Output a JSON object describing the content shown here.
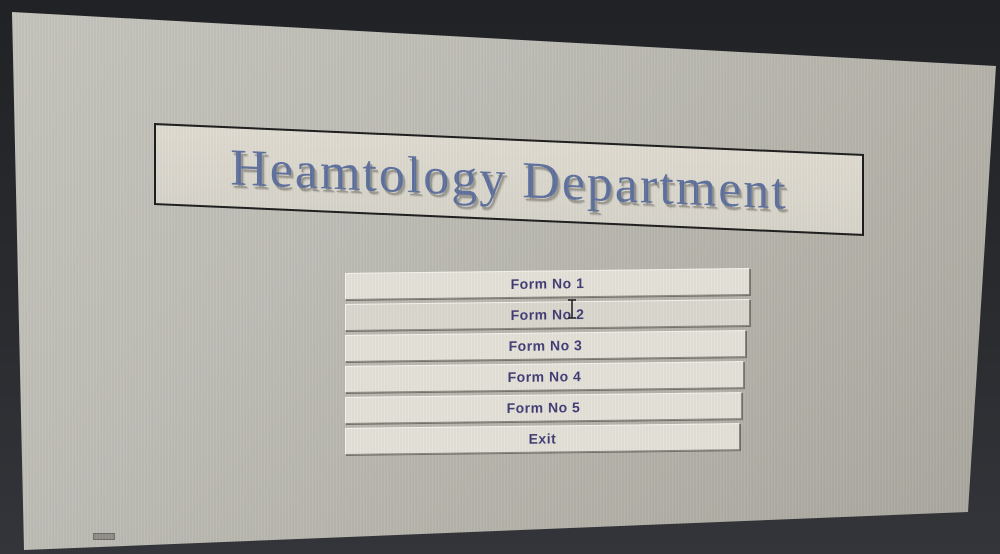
{
  "window": {
    "title": "Heamtology Department"
  },
  "menu": {
    "buttons": [
      {
        "label": "Form No 1"
      },
      {
        "label": "Form No 2"
      },
      {
        "label": "Form No 3"
      },
      {
        "label": "Form No 4"
      },
      {
        "label": "Form No 5"
      },
      {
        "label": "Exit"
      }
    ]
  },
  "icons": {
    "cursor": "text-cursor-icon"
  },
  "colors": {
    "background": "#bdbcb4",
    "title_text": "#5d6f9c",
    "button_text": "#3f3a73",
    "button_face": "#e3e0d7"
  }
}
